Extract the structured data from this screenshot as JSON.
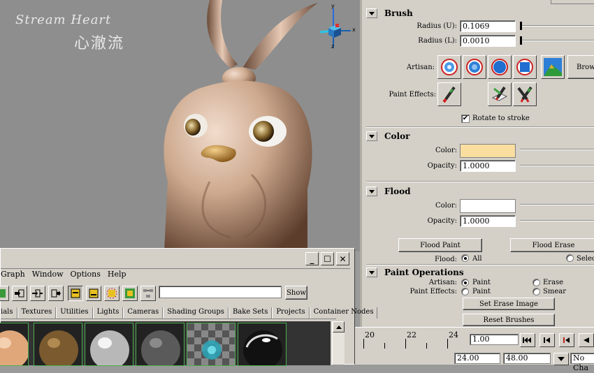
{
  "viewport": {
    "watermark_line1": "Stream Heart",
    "watermark_line2": "心澈流",
    "axis_labels": {
      "y": "y",
      "x": "x",
      "z": "z"
    }
  },
  "brush": {
    "title": "Brush",
    "radius_u_label": "Radius (U):",
    "radius_u_value": "0.1069",
    "radius_l_label": "Radius (L):",
    "radius_l_value": "0.0010",
    "artisan_label": "Artisan:",
    "browse_label": "Brows",
    "paint_effects_label": "Paint Effects:",
    "rotate_label": "Rotate to stroke",
    "rotate_checked": true
  },
  "color": {
    "title": "Color",
    "color_label": "Color:",
    "color_value": "#f9dea0",
    "opacity_label": "Opacity:",
    "opacity_value": "1.0000"
  },
  "flood": {
    "title": "Flood",
    "color_label": "Color:",
    "color_value": "#ffffff",
    "opacity_label": "Opacity:",
    "opacity_value": "1.0000",
    "flood_paint_label": "Flood Paint",
    "flood_erase_label": "Flood Erase",
    "flood_label": "Flood:",
    "all_label": "All",
    "selected_label": "Select"
  },
  "paint_operations": {
    "title": "Paint Operations",
    "artisan_label": "Artisan:",
    "paint_label": "Paint",
    "erase_label": "Erase",
    "paint_effects_label": "Paint Effects:",
    "pe_paint_label": "Paint",
    "smear_label": "Smear",
    "set_erase_image_label": "Set Erase Image",
    "reset_brushes_label": "Reset Brushes"
  },
  "timeline": {
    "ticks": [
      "20",
      "22",
      "24"
    ],
    "current_frame": "1.00",
    "start_time": "24.00",
    "end_time": "48.00",
    "character_set": "No Cha"
  },
  "hypershade": {
    "menu": [
      "Graph",
      "Window",
      "Options",
      "Help"
    ],
    "show_label": "Show",
    "tabs": [
      "ials",
      "Textures",
      "Utilities",
      "Lights",
      "Cameras",
      "Shading Groups",
      "Bake Sets",
      "Projects",
      "Container Nodes"
    ],
    "swatch_colors": [
      "#e0a77a",
      "#7a5a2e",
      "#dcdcdc",
      "#6e6e6e",
      "#2aa6b8",
      "#111111"
    ]
  }
}
